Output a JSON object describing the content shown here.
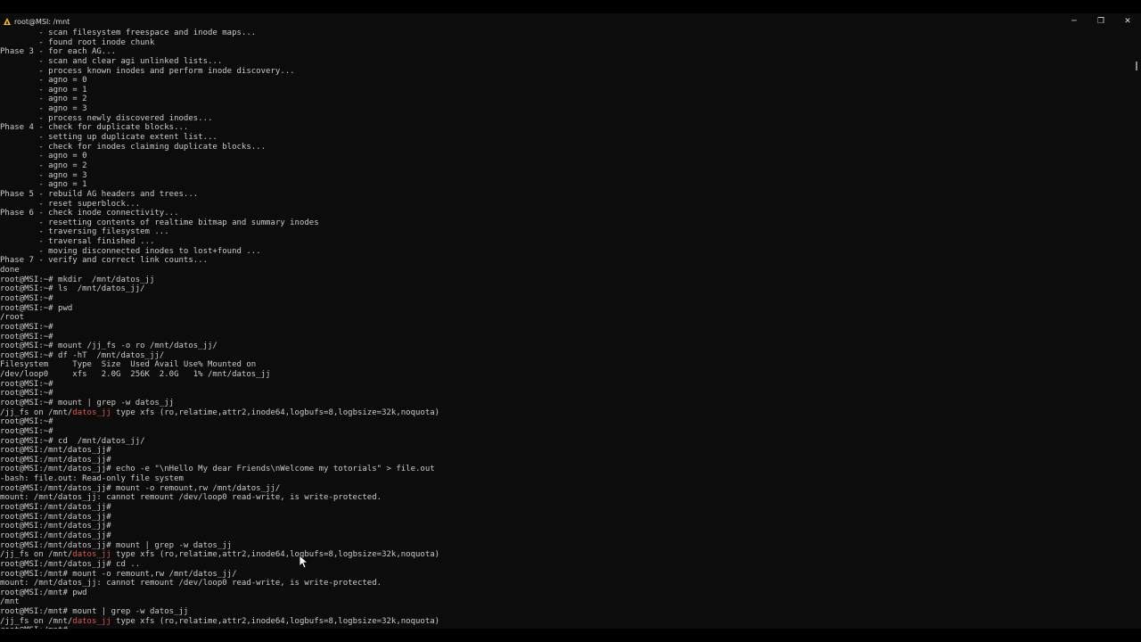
{
  "window": {
    "title": "root@MSI: /mnt",
    "icon": "linux-penguin-icon",
    "controls": {
      "minimize": "─",
      "maximize": "❐",
      "close": "✕"
    }
  },
  "colors": {
    "background": "#0c0c0c",
    "text": "#cccccc",
    "highlight": "#e5534b"
  },
  "terminal": {
    "lines": [
      [
        "        - scan filesystem freespace and inode maps..."
      ],
      [
        "        - found root inode chunk"
      ],
      [
        "Phase 3 - for each AG..."
      ],
      [
        "        - scan and clear agi unlinked lists..."
      ],
      [
        "        - process known inodes and perform inode discovery..."
      ],
      [
        "        - agno = 0"
      ],
      [
        "        - agno = 1"
      ],
      [
        "        - agno = 2"
      ],
      [
        "        - agno = 3"
      ],
      [
        "        - process newly discovered inodes..."
      ],
      [
        "Phase 4 - check for duplicate blocks..."
      ],
      [
        "        - setting up duplicate extent list..."
      ],
      [
        "        - check for inodes claiming duplicate blocks..."
      ],
      [
        "        - agno = 0"
      ],
      [
        "        - agno = 2"
      ],
      [
        "        - agno = 3"
      ],
      [
        "        - agno = 1"
      ],
      [
        "Phase 5 - rebuild AG headers and trees..."
      ],
      [
        "        - reset superblock..."
      ],
      [
        "Phase 6 - check inode connectivity..."
      ],
      [
        "        - resetting contents of realtime bitmap and summary inodes"
      ],
      [
        "        - traversing filesystem ..."
      ],
      [
        "        - traversal finished ..."
      ],
      [
        "        - moving disconnected inodes to lost+found ..."
      ],
      [
        "Phase 7 - verify and correct link counts..."
      ],
      [
        "done"
      ],
      [
        "root@MSI:~# mkdir  /mnt/datos_jj"
      ],
      [
        "root@MSI:~# ls  /mnt/datos_jj/"
      ],
      [
        "root@MSI:~#"
      ],
      [
        "root@MSI:~# pwd"
      ],
      [
        "/root"
      ],
      [
        "root@MSI:~#"
      ],
      [
        "root@MSI:~#"
      ],
      [
        "root@MSI:~# mount /jj_fs -o ro /mnt/datos_jj/"
      ],
      [
        "root@MSI:~# df -hT  /mnt/datos_jj/"
      ],
      [
        "Filesystem     Type  Size  Used Avail Use% Mounted on"
      ],
      [
        "/dev/loop0     xfs   2.0G  256K  2.0G   1% /mnt/datos_jj"
      ],
      [
        "root@MSI:~#"
      ],
      [
        "root@MSI:~#"
      ],
      [
        "root@MSI:~# mount | grep -w datos_jj"
      ],
      [
        "/jj_fs on /mnt/",
        "datos_jj",
        " type xfs (ro,relatime,attr2,inode64,logbufs=8,logbsize=32k,noquota)"
      ],
      [
        "root@MSI:~#"
      ],
      [
        "root@MSI:~#"
      ],
      [
        "root@MSI:~# cd  /mnt/datos_jj/"
      ],
      [
        "root@MSI:/mnt/datos_jj#"
      ],
      [
        "root@MSI:/mnt/datos_jj#"
      ],
      [
        "root@MSI:/mnt/datos_jj# echo -e \"\\nHello My dear Friends\\nWelcome my totorials\" > file.out"
      ],
      [
        "-bash: file.out: Read-only file system"
      ],
      [
        "root@MSI:/mnt/datos_jj# mount -o remount,rw /mnt/datos_jj/"
      ],
      [
        "mount: /mnt/datos_jj: cannot remount /dev/loop0 read-write, is write-protected."
      ],
      [
        "root@MSI:/mnt/datos_jj#"
      ],
      [
        "root@MSI:/mnt/datos_jj#"
      ],
      [
        "root@MSI:/mnt/datos_jj#"
      ],
      [
        "root@MSI:/mnt/datos_jj#"
      ],
      [
        "root@MSI:/mnt/datos_jj# mount | grep -w datos_jj"
      ],
      [
        "/jj_fs on /mnt/",
        "datos_jj",
        " type xfs (ro,relatime,attr2,inode64,logbufs=8,logbsize=32k,noquota)"
      ],
      [
        "root@MSI:/mnt/datos_jj# cd .."
      ],
      [
        "root@MSI:/mnt# mount -o remount,rw /mnt/datos_jj/"
      ],
      [
        "mount: /mnt/datos_jj: cannot remount /dev/loop0 read-write, is write-protected."
      ],
      [
        "root@MSI:/mnt# pwd"
      ],
      [
        "/mnt"
      ],
      [
        "root@MSI:/mnt# mount | grep -w datos_jj"
      ],
      [
        "/jj_fs on /mnt/",
        "datos_jj",
        " type xfs (ro,relatime,attr2,inode64,logbufs=8,logbsize=32k,noquota)"
      ],
      [
        "root@MSI:/mnt# "
      ]
    ]
  }
}
